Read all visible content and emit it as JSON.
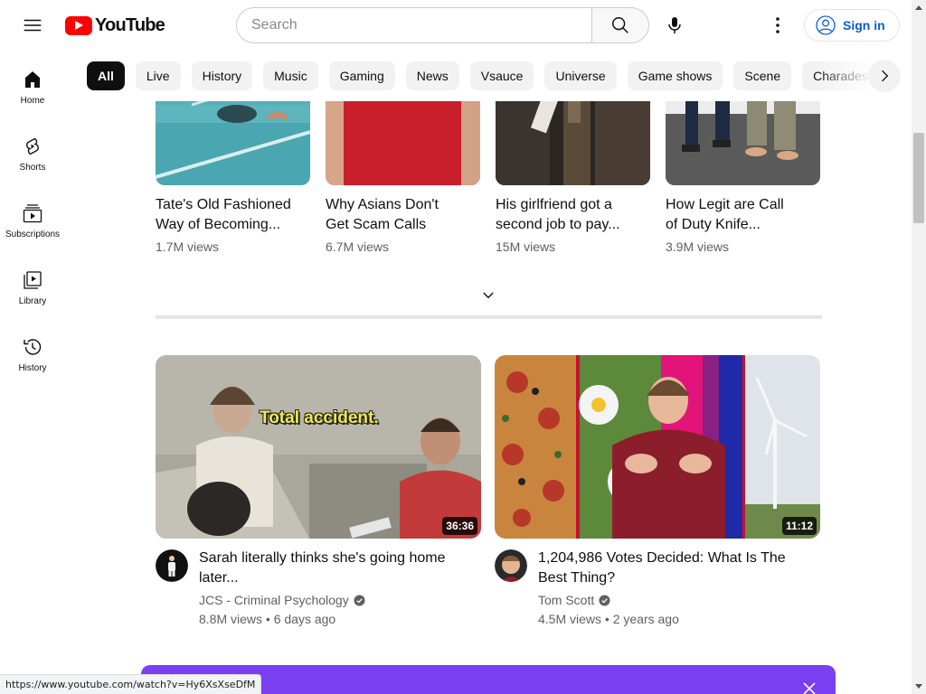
{
  "header": {
    "logo_text": "YouTube",
    "search_placeholder": "Search",
    "signin_label": "Sign in"
  },
  "sidebar": {
    "items": [
      {
        "label": "Home",
        "icon": "home-icon"
      },
      {
        "label": "Shorts",
        "icon": "shorts-icon"
      },
      {
        "label": "Subscriptions",
        "icon": "subscriptions-icon"
      },
      {
        "label": "Library",
        "icon": "library-icon"
      },
      {
        "label": "History",
        "icon": "history-icon"
      }
    ]
  },
  "chips": [
    "All",
    "Live",
    "History",
    "Music",
    "Gaming",
    "News",
    "Vsauce",
    "Universe",
    "Game shows",
    "Scene",
    "Charades"
  ],
  "shorts": [
    {
      "title_line1": "Tate's Old Fashioned",
      "title_line2": "Way of Becoming...",
      "views": "1.7M views"
    },
    {
      "title_line1": "Why Asians Don't",
      "title_line2": "Get Scam Calls",
      "views": "6.7M views"
    },
    {
      "title_line1": "His girlfriend got a",
      "title_line2": "second job to pay...",
      "views": "15M views"
    },
    {
      "title_line1": "How Legit are Call",
      "title_line2": "of Duty Knife...",
      "views": "3.9M views"
    }
  ],
  "videos": [
    {
      "title": "Sarah literally thinks she's going home later...",
      "channel": "JCS - Criminal Psychology",
      "meta": "8.8M views • 6 days ago",
      "duration": "36:36",
      "thumb_caption": "Total accident."
    },
    {
      "title": "1,204,986 Votes Decided: What Is The Best Thing?",
      "channel": "Tom Scott",
      "meta": "4.5M views • 2 years ago",
      "duration": "11:12"
    }
  ],
  "status_url": "https://www.youtube.com/watch?v=Hy6XsXseDfM",
  "colors": {
    "brand_red": "#ff0000",
    "link_blue": "#065fd4",
    "banner_purple": "#7b3ff2"
  }
}
